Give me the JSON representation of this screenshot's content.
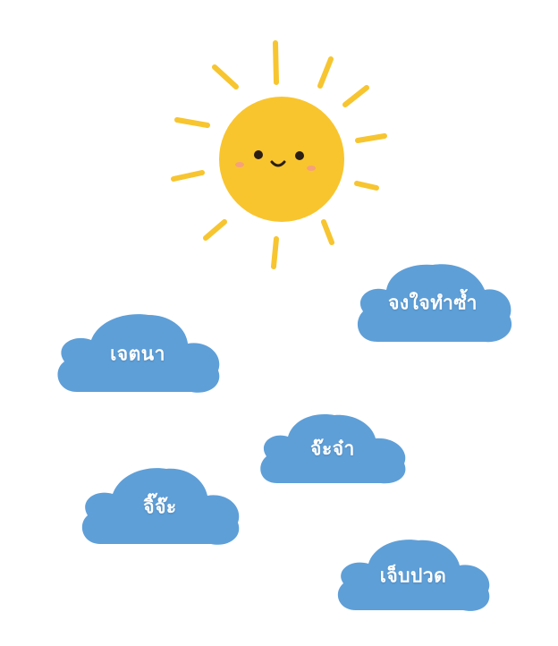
{
  "colors": {
    "sun": "#F9C52E",
    "sun_ray": "#F7C530",
    "cloud": "#5E9FD8",
    "cheek": "#F59A8A",
    "face": "#2B1E14",
    "label": "#FFFFFF"
  },
  "clouds": [
    {
      "id": "cloud-1",
      "label": "จงใจทำซ้ำ"
    },
    {
      "id": "cloud-2",
      "label": "เจตนา"
    },
    {
      "id": "cloud-3",
      "label": "จ๊ะจ๋า"
    },
    {
      "id": "cloud-4",
      "label": "จิ๊จ๊ะ"
    },
    {
      "id": "cloud-5",
      "label": "เจ็บปวด"
    }
  ]
}
